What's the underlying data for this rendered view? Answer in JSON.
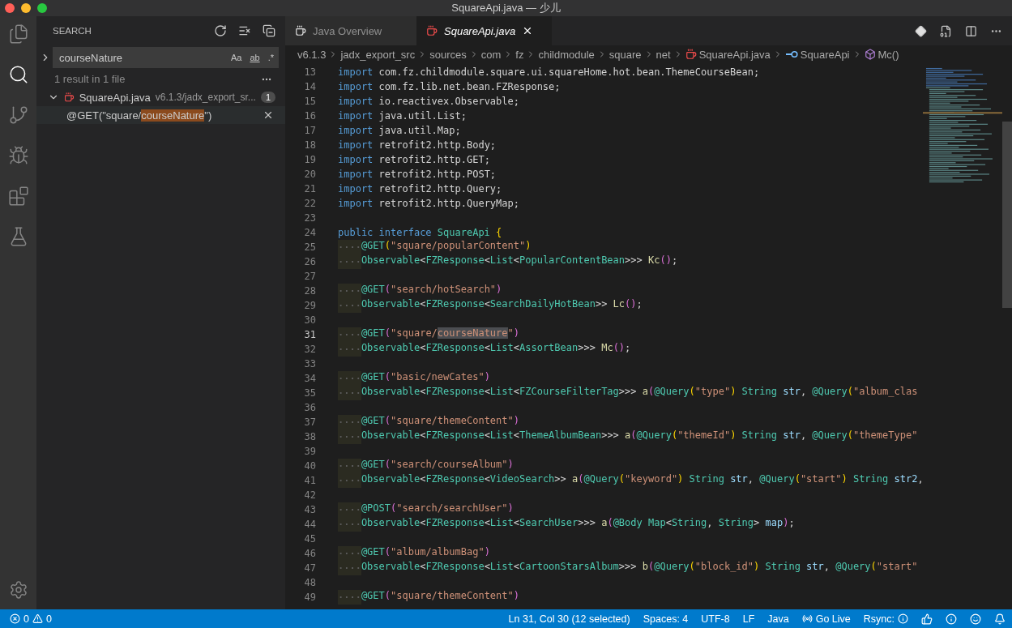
{
  "window": {
    "title": "SquareApi.java — 少儿"
  },
  "activity_bar": [
    {
      "kind": "explorer",
      "selected": false
    },
    {
      "kind": "search",
      "selected": true
    },
    {
      "kind": "source-control",
      "selected": false
    },
    {
      "kind": "debug",
      "selected": false
    },
    {
      "kind": "extensions",
      "selected": false
    },
    {
      "kind": "testing",
      "selected": false
    }
  ],
  "sidebar": {
    "title": "SEARCH",
    "search": {
      "value": "courseNature",
      "toggles": [
        {
          "label": "Aa",
          "on": false
        },
        {
          "label": "ab",
          "on": false
        },
        {
          "label": ".*",
          "on": false
        }
      ]
    },
    "summary": "1 result in 1 file",
    "results": [
      {
        "file": "SquareApi.java",
        "path": "v6.1.3/jadx_export_sr...",
        "count": "1",
        "expanded": true,
        "children": [
          {
            "before": "@GET(\"square/",
            "match": "courseNature",
            "after": "\")"
          }
        ]
      }
    ]
  },
  "tabs": [
    {
      "label": "Java Overview",
      "selected": false
    },
    {
      "label": "SquareApi.java",
      "selected": true
    }
  ],
  "breadcrumbs": [
    {
      "kind": "folder",
      "label": "v6.1.3"
    },
    {
      "kind": "folder",
      "label": "jadx_export_src"
    },
    {
      "kind": "folder",
      "label": "sources"
    },
    {
      "kind": "folder",
      "label": "com"
    },
    {
      "kind": "folder",
      "label": "fz"
    },
    {
      "kind": "folder",
      "label": "childmodule"
    },
    {
      "kind": "folder",
      "label": "square"
    },
    {
      "kind": "folder",
      "label": "net"
    },
    {
      "kind": "file",
      "label": "SquareApi.java"
    },
    {
      "kind": "interface",
      "label": "SquareApi"
    },
    {
      "kind": "method",
      "label": "Mc()"
    }
  ],
  "code": [
    {
      "n": "13",
      "active": false,
      "indent": false,
      "tokens": [
        {
          "kind": "keyword",
          "text": "import"
        },
        {
          "kind": "plain",
          "text": " com.fz.childmodule.square.ui.squareHome.hot.bean.ThemeCourseBean;"
        }
      ]
    },
    {
      "n": "14",
      "active": false,
      "indent": false,
      "tokens": [
        {
          "kind": "keyword",
          "text": "import"
        },
        {
          "kind": "plain",
          "text": " com.fz.lib.net.bean.FZResponse;"
        }
      ]
    },
    {
      "n": "15",
      "active": false,
      "indent": false,
      "tokens": [
        {
          "kind": "keyword",
          "text": "import"
        },
        {
          "kind": "plain",
          "text": " io.reactivex.Observable;"
        }
      ]
    },
    {
      "n": "16",
      "active": false,
      "indent": false,
      "tokens": [
        {
          "kind": "keyword",
          "text": "import"
        },
        {
          "kind": "plain",
          "text": " java.util.List;"
        }
      ]
    },
    {
      "n": "17",
      "active": false,
      "indent": false,
      "tokens": [
        {
          "kind": "keyword",
          "text": "import"
        },
        {
          "kind": "plain",
          "text": " java.util.Map;"
        }
      ]
    },
    {
      "n": "18",
      "active": false,
      "indent": false,
      "tokens": [
        {
          "kind": "keyword",
          "text": "import"
        },
        {
          "kind": "plain",
          "text": " retrofit2.http.Body;"
        }
      ]
    },
    {
      "n": "19",
      "active": false,
      "indent": false,
      "tokens": [
        {
          "kind": "keyword",
          "text": "import"
        },
        {
          "kind": "plain",
          "text": " retrofit2.http.GET;"
        }
      ]
    },
    {
      "n": "20",
      "active": false,
      "indent": false,
      "tokens": [
        {
          "kind": "keyword",
          "text": "import"
        },
        {
          "kind": "plain",
          "text": " retrofit2.http.POST;"
        }
      ]
    },
    {
      "n": "21",
      "active": false,
      "indent": false,
      "tokens": [
        {
          "kind": "keyword",
          "text": "import"
        },
        {
          "kind": "plain",
          "text": " retrofit2.http.Query;"
        }
      ]
    },
    {
      "n": "22",
      "active": false,
      "indent": false,
      "tokens": [
        {
          "kind": "keyword",
          "text": "import"
        },
        {
          "kind": "plain",
          "text": " retrofit2.http.QueryMap;"
        }
      ]
    },
    {
      "n": "23",
      "active": false
    },
    {
      "n": "24",
      "active": false,
      "indent": false,
      "tokens": [
        {
          "kind": "keyword",
          "text": "public interface"
        },
        {
          "kind": "type",
          "text": " SquareApi"
        },
        {
          "kind": "brace",
          "text": " {"
        }
      ]
    },
    {
      "n": "25",
      "active": false,
      "indent": true,
      "tokens": [
        {
          "kind": "annotation",
          "text": "@GET"
        },
        {
          "kind": "brace",
          "text": "("
        },
        {
          "kind": "string",
          "text": "\"square/popularContent\""
        },
        {
          "kind": "brace",
          "text": ")"
        }
      ]
    },
    {
      "n": "26",
      "active": false,
      "indent": true,
      "tokens": [
        {
          "kind": "type",
          "text": "Observable"
        },
        {
          "kind": "plain",
          "text": "<"
        },
        {
          "kind": "type",
          "text": "FZResponse"
        },
        {
          "kind": "plain",
          "text": "<"
        },
        {
          "kind": "type",
          "text": "List"
        },
        {
          "kind": "plain",
          "text": "<"
        },
        {
          "kind": "type",
          "text": "PopularContentBean"
        },
        {
          "kind": "plain",
          "text": ">>>"
        },
        {
          "kind": "function",
          "text": " Kc"
        },
        {
          "kind": "bracket",
          "text": "()"
        },
        {
          "kind": "plain",
          "text": ";"
        }
      ]
    },
    {
      "n": "27",
      "active": false
    },
    {
      "n": "28",
      "active": false,
      "indent": true,
      "tokens": [
        {
          "kind": "annotation",
          "text": "@GET"
        },
        {
          "kind": "bracket",
          "text": "("
        },
        {
          "kind": "string",
          "text": "\"search/hotSearch\""
        },
        {
          "kind": "bracket",
          "text": ")"
        }
      ]
    },
    {
      "n": "29",
      "active": false,
      "indent": true,
      "tokens": [
        {
          "kind": "type",
          "text": "Observable"
        },
        {
          "kind": "plain",
          "text": "<"
        },
        {
          "kind": "type",
          "text": "FZResponse"
        },
        {
          "kind": "plain",
          "text": "<"
        },
        {
          "kind": "type",
          "text": "SearchDailyHotBean"
        },
        {
          "kind": "plain",
          "text": ">>"
        },
        {
          "kind": "function",
          "text": " Lc"
        },
        {
          "kind": "bracket",
          "text": "()"
        },
        {
          "kind": "plain",
          "text": ";"
        }
      ]
    },
    {
      "n": "30",
      "active": false
    },
    {
      "n": "31",
      "active": true,
      "indent": true,
      "tokens": [
        {
          "kind": "annotation",
          "text": "@GET"
        },
        {
          "kind": "bracket",
          "text": "("
        },
        {
          "kind": "string",
          "text": "\"square/"
        },
        {
          "kind": "match",
          "text": "courseNature"
        },
        {
          "kind": "string",
          "text": "\""
        },
        {
          "kind": "bracket",
          "text": ")"
        }
      ]
    },
    {
      "n": "32",
      "active": false,
      "indent": true,
      "tokens": [
        {
          "kind": "type",
          "text": "Observable"
        },
        {
          "kind": "plain",
          "text": "<"
        },
        {
          "kind": "type",
          "text": "FZResponse"
        },
        {
          "kind": "plain",
          "text": "<"
        },
        {
          "kind": "type",
          "text": "List"
        },
        {
          "kind": "plain",
          "text": "<"
        },
        {
          "kind": "type",
          "text": "AssortBean"
        },
        {
          "kind": "plain",
          "text": ">>>"
        },
        {
          "kind": "function",
          "text": " Mc"
        },
        {
          "kind": "bracket",
          "text": "()"
        },
        {
          "kind": "plain",
          "text": ";"
        }
      ]
    },
    {
      "n": "33",
      "active": false
    },
    {
      "n": "34",
      "active": false,
      "indent": true,
      "tokens": [
        {
          "kind": "annotation",
          "text": "@GET"
        },
        {
          "kind": "bracket",
          "text": "("
        },
        {
          "kind": "string",
          "text": "\"basic/newCates\""
        },
        {
          "kind": "bracket",
          "text": ")"
        }
      ]
    },
    {
      "n": "35",
      "active": false,
      "indent": true,
      "tokens": [
        {
          "kind": "type",
          "text": "Observable"
        },
        {
          "kind": "plain",
          "text": "<"
        },
        {
          "kind": "type",
          "text": "FZResponse"
        },
        {
          "kind": "plain",
          "text": "<"
        },
        {
          "kind": "type",
          "text": "List"
        },
        {
          "kind": "plain",
          "text": "<"
        },
        {
          "kind": "type",
          "text": "FZCourseFilterTag"
        },
        {
          "kind": "plain",
          "text": ">>>"
        },
        {
          "kind": "function",
          "text": " a"
        },
        {
          "kind": "bracket",
          "text": "("
        },
        {
          "kind": "annotation",
          "text": "@Query"
        },
        {
          "kind": "brace",
          "text": "("
        },
        {
          "kind": "string",
          "text": "\"type\""
        },
        {
          "kind": "brace",
          "text": ")"
        },
        {
          "kind": "type",
          "text": " String"
        },
        {
          "kind": "variable",
          "text": " str"
        },
        {
          "kind": "plain",
          "text": ","
        },
        {
          "kind": "annotation",
          "text": " @Query"
        },
        {
          "kind": "brace",
          "text": "("
        },
        {
          "kind": "string",
          "text": "\"album_clas"
        }
      ]
    },
    {
      "n": "36",
      "active": false
    },
    {
      "n": "37",
      "active": false,
      "indent": true,
      "tokens": [
        {
          "kind": "annotation",
          "text": "@GET"
        },
        {
          "kind": "bracket",
          "text": "("
        },
        {
          "kind": "string",
          "text": "\"square/themeContent\""
        },
        {
          "kind": "bracket",
          "text": ")"
        }
      ]
    },
    {
      "n": "38",
      "active": false,
      "indent": true,
      "tokens": [
        {
          "kind": "type",
          "text": "Observable"
        },
        {
          "kind": "plain",
          "text": "<"
        },
        {
          "kind": "type",
          "text": "FZResponse"
        },
        {
          "kind": "plain",
          "text": "<"
        },
        {
          "kind": "type",
          "text": "List"
        },
        {
          "kind": "plain",
          "text": "<"
        },
        {
          "kind": "type",
          "text": "ThemeAlbumBean"
        },
        {
          "kind": "plain",
          "text": ">>>"
        },
        {
          "kind": "function",
          "text": " a"
        },
        {
          "kind": "bracket",
          "text": "("
        },
        {
          "kind": "annotation",
          "text": "@Query"
        },
        {
          "kind": "brace",
          "text": "("
        },
        {
          "kind": "string",
          "text": "\"themeId\""
        },
        {
          "kind": "brace",
          "text": ")"
        },
        {
          "kind": "type",
          "text": " String"
        },
        {
          "kind": "variable",
          "text": " str"
        },
        {
          "kind": "plain",
          "text": ","
        },
        {
          "kind": "annotation",
          "text": " @Query"
        },
        {
          "kind": "brace",
          "text": "("
        },
        {
          "kind": "string",
          "text": "\"themeType\""
        }
      ]
    },
    {
      "n": "39",
      "active": false
    },
    {
      "n": "40",
      "active": false,
      "indent": true,
      "tokens": [
        {
          "kind": "annotation",
          "text": "@GET"
        },
        {
          "kind": "bracket",
          "text": "("
        },
        {
          "kind": "string",
          "text": "\"search/courseAlbum\""
        },
        {
          "kind": "bracket",
          "text": ")"
        }
      ]
    },
    {
      "n": "41",
      "active": false,
      "indent": true,
      "tokens": [
        {
          "kind": "type",
          "text": "Observable"
        },
        {
          "kind": "plain",
          "text": "<"
        },
        {
          "kind": "type",
          "text": "FZResponse"
        },
        {
          "kind": "plain",
          "text": "<"
        },
        {
          "kind": "type",
          "text": "VideoSearch"
        },
        {
          "kind": "plain",
          "text": ">>"
        },
        {
          "kind": "function",
          "text": " a"
        },
        {
          "kind": "bracket",
          "text": "("
        },
        {
          "kind": "annotation",
          "text": "@Query"
        },
        {
          "kind": "brace",
          "text": "("
        },
        {
          "kind": "string",
          "text": "\"keyword\""
        },
        {
          "kind": "brace",
          "text": ")"
        },
        {
          "kind": "type",
          "text": " String"
        },
        {
          "kind": "variable",
          "text": " str"
        },
        {
          "kind": "plain",
          "text": ","
        },
        {
          "kind": "annotation",
          "text": " @Query"
        },
        {
          "kind": "brace",
          "text": "("
        },
        {
          "kind": "string",
          "text": "\"start\""
        },
        {
          "kind": "brace",
          "text": ")"
        },
        {
          "kind": "type",
          "text": " String"
        },
        {
          "kind": "variable",
          "text": " str2"
        },
        {
          "kind": "plain",
          "text": ","
        }
      ]
    },
    {
      "n": "42",
      "active": false
    },
    {
      "n": "43",
      "active": false,
      "indent": true,
      "tokens": [
        {
          "kind": "annotation",
          "text": "@POST"
        },
        {
          "kind": "bracket",
          "text": "("
        },
        {
          "kind": "string",
          "text": "\"search/searchUser\""
        },
        {
          "kind": "bracket",
          "text": ")"
        }
      ]
    },
    {
      "n": "44",
      "active": false,
      "indent": true,
      "tokens": [
        {
          "kind": "type",
          "text": "Observable"
        },
        {
          "kind": "plain",
          "text": "<"
        },
        {
          "kind": "type",
          "text": "FZResponse"
        },
        {
          "kind": "plain",
          "text": "<"
        },
        {
          "kind": "type",
          "text": "List"
        },
        {
          "kind": "plain",
          "text": "<"
        },
        {
          "kind": "type",
          "text": "SearchUser"
        },
        {
          "kind": "plain",
          "text": ">>>"
        },
        {
          "kind": "function",
          "text": " a"
        },
        {
          "kind": "bracket",
          "text": "("
        },
        {
          "kind": "annotation",
          "text": "@Body"
        },
        {
          "kind": "type",
          "text": " Map"
        },
        {
          "kind": "plain",
          "text": "<"
        },
        {
          "kind": "type",
          "text": "String"
        },
        {
          "kind": "plain",
          "text": ","
        },
        {
          "kind": "type",
          "text": " String"
        },
        {
          "kind": "plain",
          "text": ">"
        },
        {
          "kind": "variable",
          "text": " map"
        },
        {
          "kind": "bracket",
          "text": ")"
        },
        {
          "kind": "plain",
          "text": ";"
        }
      ]
    },
    {
      "n": "45",
      "active": false
    },
    {
      "n": "46",
      "active": false,
      "indent": true,
      "tokens": [
        {
          "kind": "annotation",
          "text": "@GET"
        },
        {
          "kind": "bracket",
          "text": "("
        },
        {
          "kind": "string",
          "text": "\"album/albumBag\""
        },
        {
          "kind": "bracket",
          "text": ")"
        }
      ]
    },
    {
      "n": "47",
      "active": false,
      "indent": true,
      "tokens": [
        {
          "kind": "type",
          "text": "Observable"
        },
        {
          "kind": "plain",
          "text": "<"
        },
        {
          "kind": "type",
          "text": "FZResponse"
        },
        {
          "kind": "plain",
          "text": "<"
        },
        {
          "kind": "type",
          "text": "List"
        },
        {
          "kind": "plain",
          "text": "<"
        },
        {
          "kind": "type",
          "text": "CartoonStarsAlbum"
        },
        {
          "kind": "plain",
          "text": ">>>"
        },
        {
          "kind": "function",
          "text": " b"
        },
        {
          "kind": "bracket",
          "text": "("
        },
        {
          "kind": "annotation",
          "text": "@Query"
        },
        {
          "kind": "brace",
          "text": "("
        },
        {
          "kind": "string",
          "text": "\"block_id\""
        },
        {
          "kind": "brace",
          "text": ")"
        },
        {
          "kind": "type",
          "text": " String"
        },
        {
          "kind": "variable",
          "text": " str"
        },
        {
          "kind": "plain",
          "text": ","
        },
        {
          "kind": "annotation",
          "text": " @Query"
        },
        {
          "kind": "brace",
          "text": "("
        },
        {
          "kind": "string",
          "text": "\"start\""
        }
      ]
    },
    {
      "n": "48",
      "active": false
    },
    {
      "n": "49",
      "active": false,
      "indent": true,
      "tokens": [
        {
          "kind": "annotation",
          "text": "@GET"
        },
        {
          "kind": "bracket",
          "text": "("
        },
        {
          "kind": "string",
          "text": "\"square/themeContent\""
        },
        {
          "kind": "bracket",
          "text": ")"
        }
      ]
    }
  ],
  "status_bar": {
    "errors": "0",
    "warnings": "0",
    "items": [
      {
        "kind": "text",
        "label": "Ln 31, Col 30 (12 selected)"
      },
      {
        "kind": "text",
        "label": "Spaces: 4"
      },
      {
        "kind": "text",
        "label": "UTF-8"
      },
      {
        "kind": "text",
        "label": "LF"
      },
      {
        "kind": "text",
        "label": "Java"
      },
      {
        "kind": "live",
        "label": "Go Live"
      },
      {
        "kind": "rsync",
        "label": "Rsync:"
      },
      {
        "kind": "like"
      },
      {
        "kind": "info"
      },
      {
        "kind": "feedback"
      },
      {
        "kind": "bell"
      }
    ]
  }
}
